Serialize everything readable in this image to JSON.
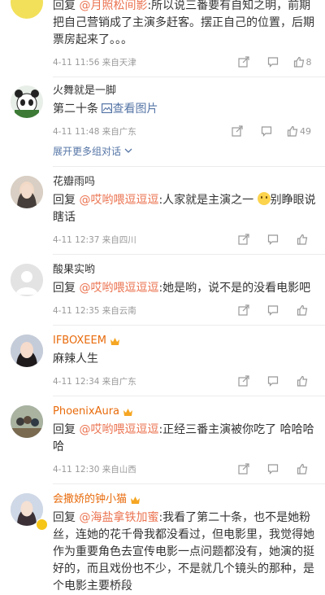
{
  "comments": [
    {
      "reply_prefix": "回复",
      "mention": "@月照松间影",
      "text": ":所以说三番要有自知之明，前期把自己营销成了主演多赶客。摆正自己的位置，后期票房起来了。。。",
      "time": "4-11 11:56",
      "source": "来自天津",
      "likes": "8"
    },
    {
      "name": "火舞就是一脚",
      "text": "第二十条",
      "image_link": "查看图片",
      "time": "4-11 11:48",
      "source": "来自广东",
      "likes": "49",
      "expand": "展开更多组对话"
    },
    {
      "name": "花瓣雨吗",
      "reply_prefix": "回复",
      "mention": "@哎哟喂逗逗逗",
      "text": ":人家就是主演之一",
      "text2": "别睁眼说瞎话",
      "time": "4-11 12:37",
      "source": "来自四川"
    },
    {
      "name": "酸果实哟",
      "reply_prefix": "回复",
      "mention": "@哎哟喂逗逗逗",
      "text": ":她是哟，说不是的没看电影吧",
      "time": "4-11 12:35",
      "source": "来自云南"
    },
    {
      "name": "IFBOXEEM",
      "text": "麻辣人生",
      "time": "4-11 12:34",
      "source": "来自广东"
    },
    {
      "name": "PhoenixAura",
      "reply_prefix": "回复",
      "mention": "@哎哟喂逗逗逗",
      "text": ":正经三番主演被你吃了 哈哈哈哈",
      "time": "4-11 12:30",
      "source": "来自山西"
    },
    {
      "name": "会撒娇的钟小猫",
      "reply_prefix": "回复",
      "mention": "@海盐拿铁加蜜",
      "text": ":我看了第二十条，也不是她粉丝，连她的花千骨我都没看过，但电影里，我觉得她作为重要角色去宣传电影一点问题都没有，她演的挺好的，而且戏份也不少，不是就几个镜头的那种，是个电影主要桥段"
    }
  ],
  "colors": {
    "mention": "#eb7350",
    "link": "#5575a6",
    "vip_name": "#e86b0c"
  }
}
